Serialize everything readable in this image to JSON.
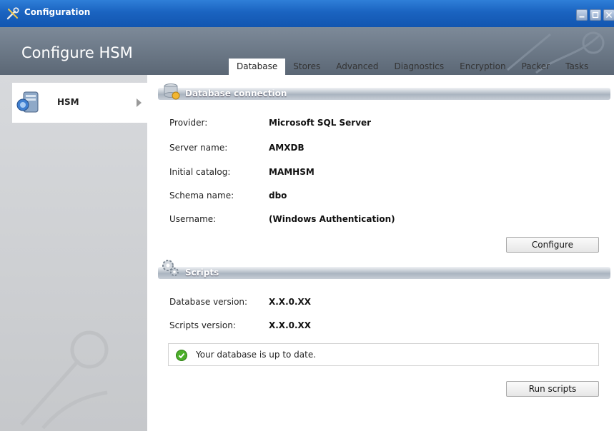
{
  "window": {
    "title": "Configuration",
    "heading": "Configure HSM"
  },
  "tabs": [
    "Database",
    "Stores",
    "Advanced",
    "Diagnostics",
    "Encryption",
    "Packer",
    "Tasks"
  ],
  "active_tab": "Database",
  "sidebar": {
    "items": [
      {
        "label": "HSM"
      }
    ]
  },
  "database_connection": {
    "title": "Database connection",
    "provider_label": "Provider:",
    "provider_value": "Microsoft SQL Server",
    "server_label": "Server name:",
    "server_value": "AMXDB",
    "catalog_label": "Initial catalog:",
    "catalog_value": "MAMHSM",
    "schema_label": "Schema name:",
    "schema_value": "dbo",
    "username_label": "Username:",
    "username_value": "(Windows Authentication)",
    "configure_button": "Configure"
  },
  "scripts": {
    "title": "Scripts",
    "db_version_label": "Database version:",
    "db_version_value": "X.X.0.XX",
    "scripts_version_label": "Scripts version:",
    "scripts_version_value": "X.X.0.XX",
    "status_message": "Your database is up to date.",
    "run_button": "Run scripts"
  },
  "colors": {
    "titlebar": "#1a63c0",
    "header": "#6b7786",
    "sidebar": "#d0d2d5",
    "ok": "#4caf2a"
  },
  "icons": {
    "app": "tools-icon",
    "nav": "database-icon",
    "db_section": "database-key-icon",
    "scripts_section": "gears-icon",
    "status": "checkmark-icon"
  }
}
